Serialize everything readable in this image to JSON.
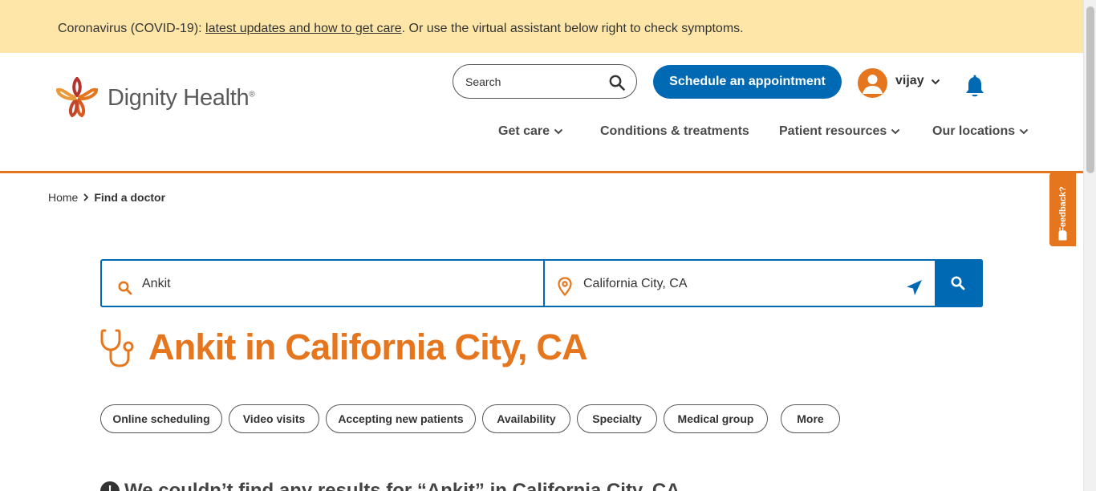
{
  "alert": {
    "prefix": "Coronavirus (COVID-19): ",
    "link": "latest updates and how to get care",
    "suffix": ". Or use the virtual assistant below right to check symptoms."
  },
  "header": {
    "logo_text": "Dignity Health",
    "logo_mark": "®",
    "search_placeholder": "Search",
    "schedule_label": "Schedule an appointment",
    "user_name": "vijay",
    "nav": {
      "get_care": "Get care",
      "conditions": "Conditions & treatments",
      "patient_resources": "Patient resources",
      "locations": "Our locations"
    }
  },
  "breadcrumb": {
    "home": "Home",
    "current": "Find a doctor"
  },
  "feedback_label": "Feedback?",
  "doctor_search": {
    "query": "Ankit",
    "location": "California City, CA"
  },
  "results_title": "Ankit in California City, CA",
  "filters": {
    "online_scheduling": "Online scheduling",
    "video_visits": "Video visits",
    "accepting_new_patients": "Accepting new patients",
    "availability": "Availability",
    "specialty": "Specialty",
    "medical_group": "Medical group",
    "more": "More"
  },
  "no_results": {
    "icon": "!",
    "message": "We couldn’t find any results for “Ankit” in California City, CA"
  },
  "colors": {
    "brand_orange": "#e5761d",
    "brand_blue": "#0069b3",
    "alert_bg": "#fde6a7"
  }
}
